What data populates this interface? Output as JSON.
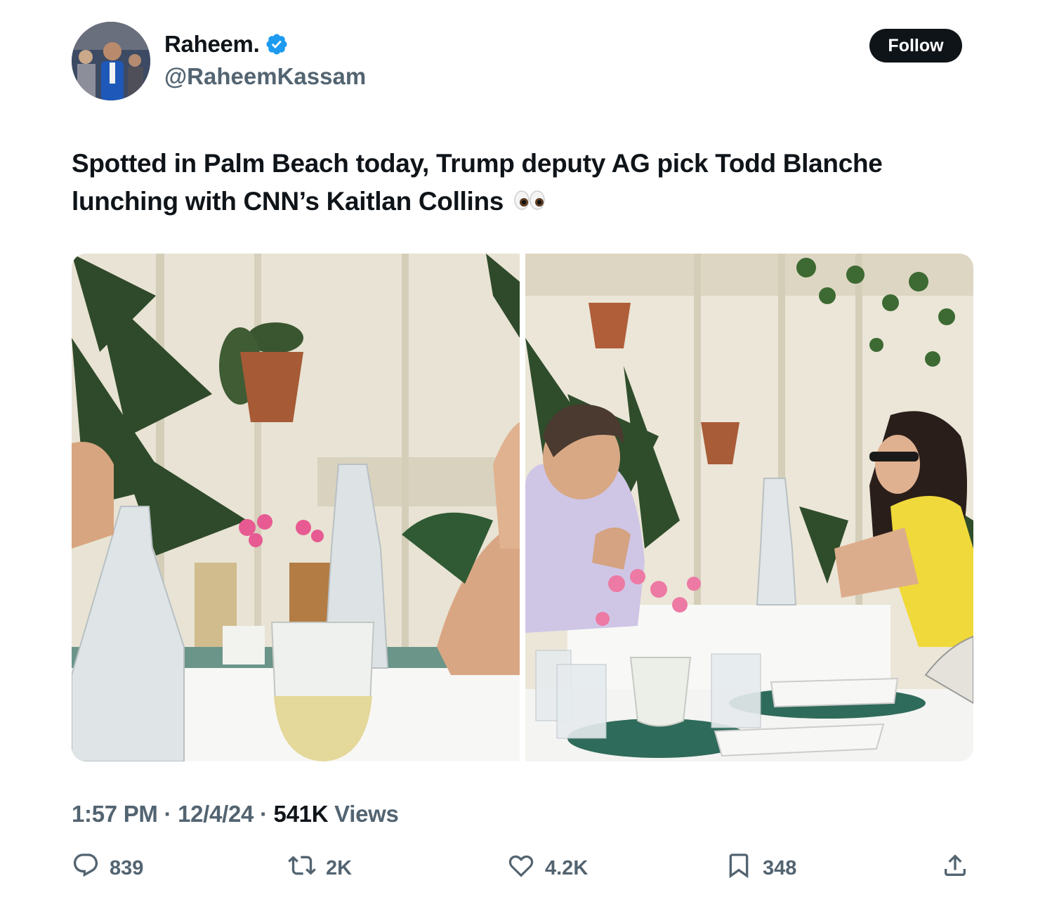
{
  "author": {
    "display_name": "Raheem.",
    "handle": "@RaheemKassam",
    "verified": true,
    "avatar_icon": "profile-photo"
  },
  "follow_label": "Follow",
  "tweet": {
    "text": "Spotted in Palm Beach today, Trump deputy AG pick Todd Blanche lunching with CNN’s Kaitlan Collins",
    "emoji_icon": "eyes-emoji"
  },
  "media": {
    "photo_count": 2
  },
  "meta": {
    "time": "1:57 PM",
    "separator": "·",
    "date": "12/4/24",
    "views_count": "541K",
    "views_label": "Views"
  },
  "actions": {
    "replies": "839",
    "reposts": "2K",
    "likes": "4.2K",
    "bookmarks": "348"
  },
  "colors": {
    "accent": "#1d9bf0",
    "text": "#0f1419",
    "secondary": "#536471"
  }
}
